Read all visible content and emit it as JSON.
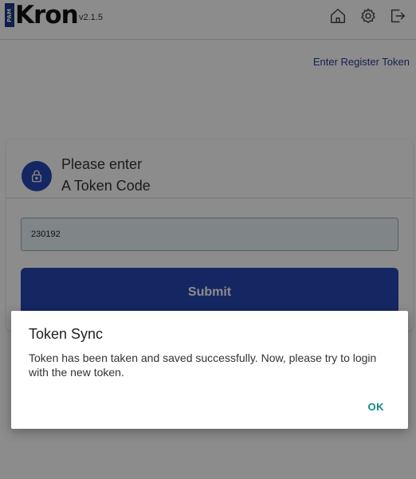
{
  "header": {
    "logo_badge": "PAM",
    "logo_text": "Kron",
    "version": "v2.1.5",
    "icons": [
      "home-icon",
      "gear-icon",
      "logout-icon"
    ]
  },
  "register_link": "Enter Register Token",
  "card": {
    "prompt_line1": "Please enter",
    "prompt_line2": "A Token Code",
    "token_value": "230192",
    "submit_label": "Submit"
  },
  "dialog": {
    "title": "Token Sync",
    "message": "Token has been taken and saved successfully. Now, please try to login with the new token.",
    "ok_label": "OK"
  },
  "colors": {
    "primary": "#2748b3",
    "link": "#233f94",
    "ok_button": "#0e8a86",
    "overlay": "rgba(0,0,0,0.45)"
  }
}
